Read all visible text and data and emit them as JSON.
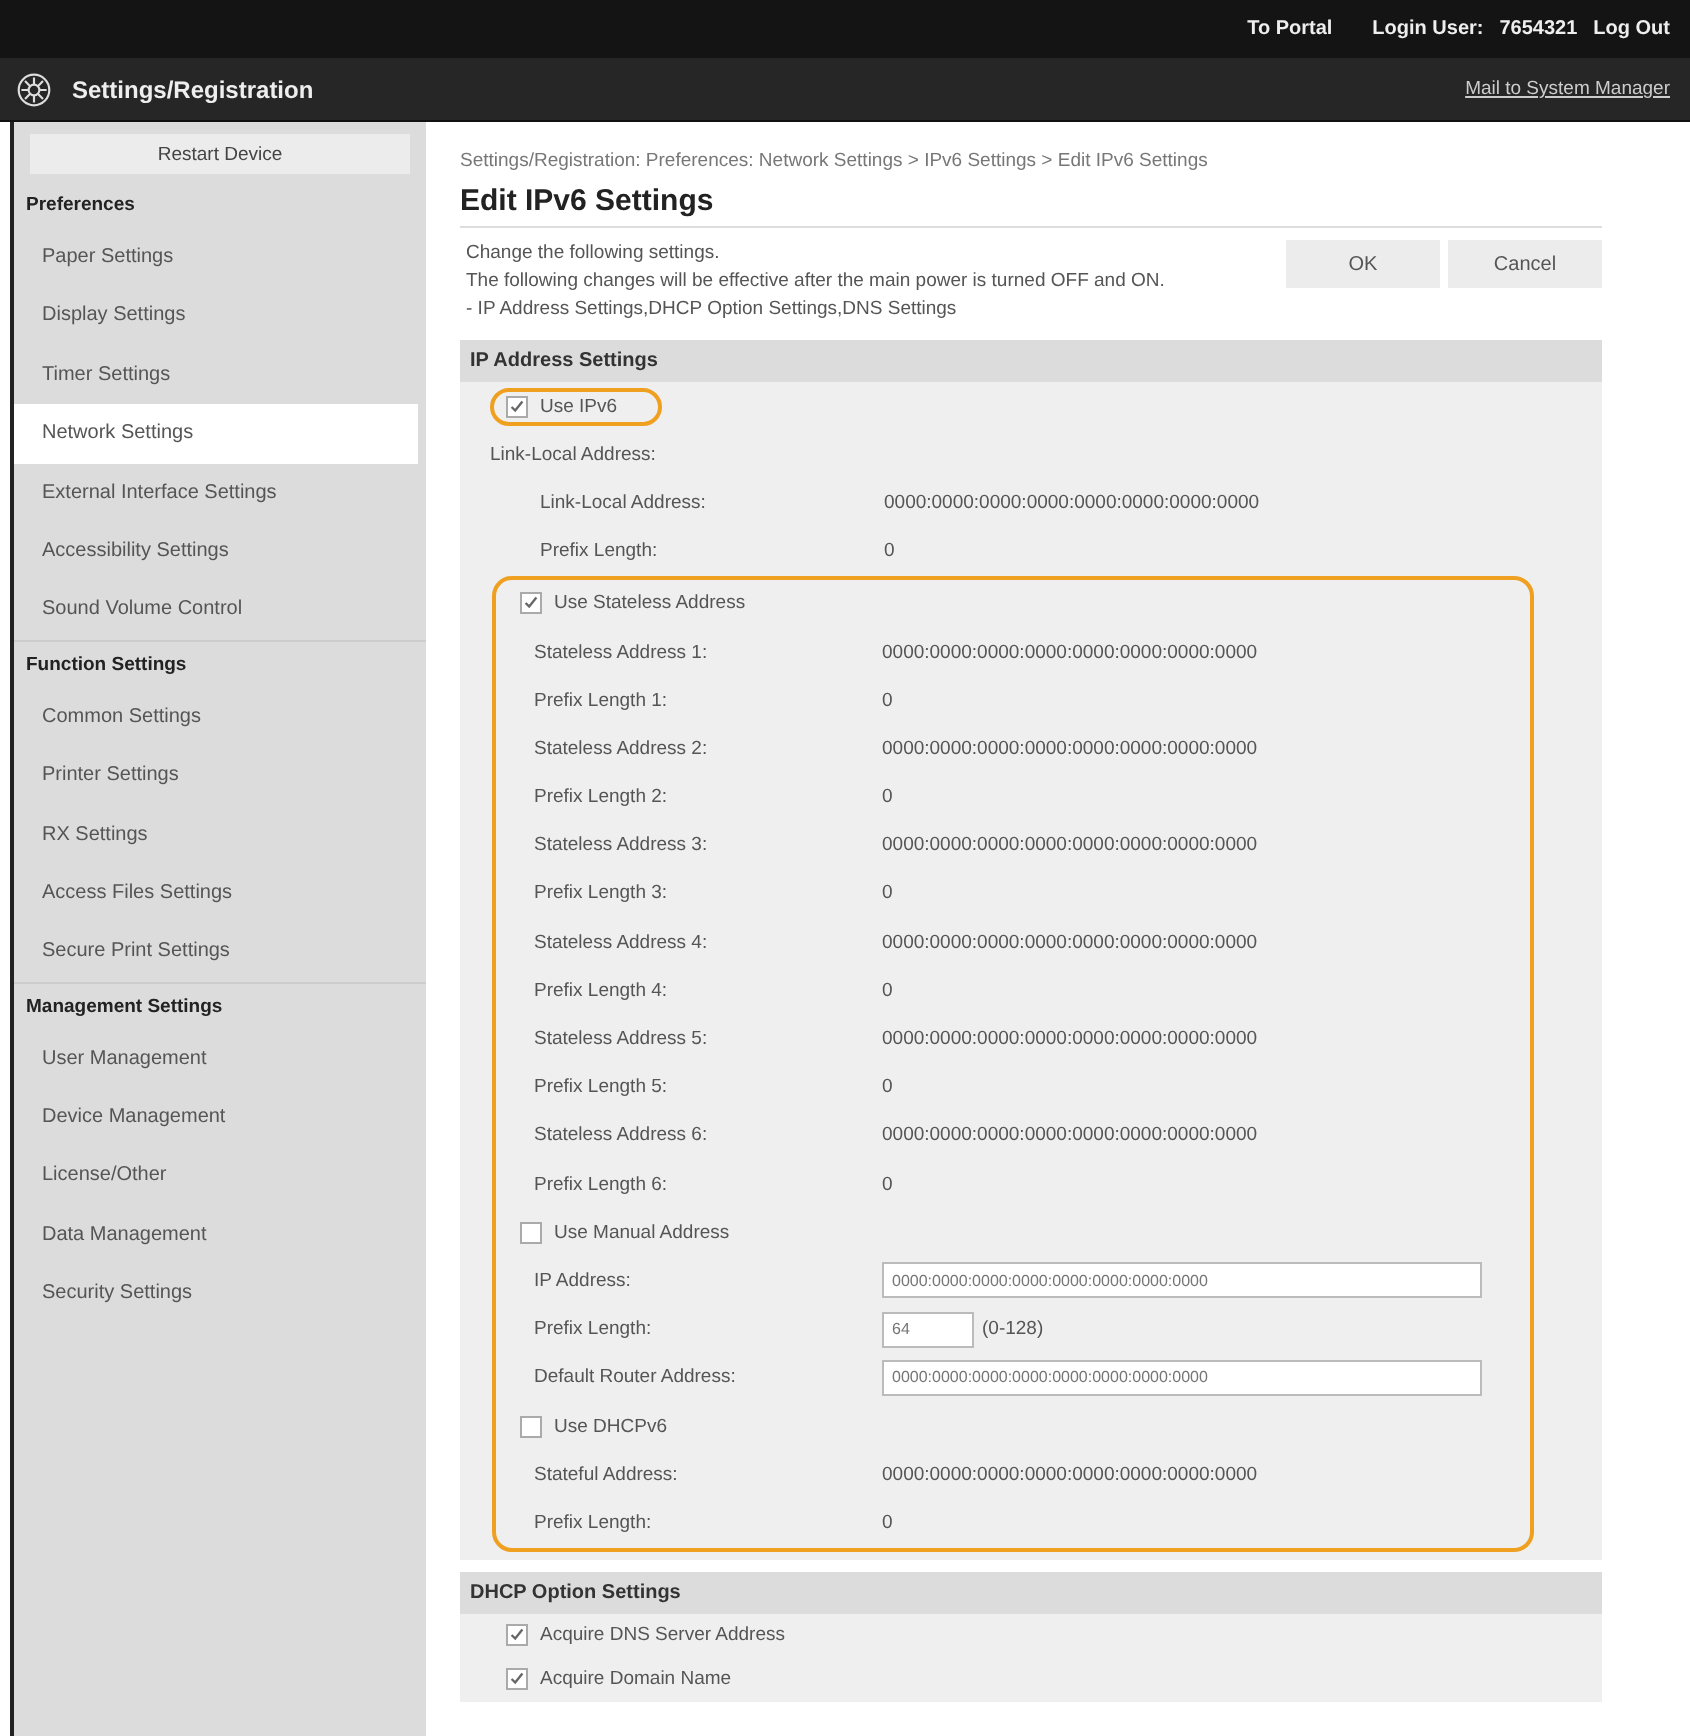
{
  "top_bar": {
    "portal_link": "To Portal",
    "login_label": "Login User:",
    "login_user": "7654321",
    "logout_link": "Log Out"
  },
  "app_bar": {
    "title": "Settings/Registration",
    "mail_link": "Mail to System Manager"
  },
  "sidebar": {
    "restart_button": "Restart Device",
    "groups": [
      {
        "title": "Preferences",
        "items": [
          {
            "label": "Paper Settings",
            "selected": false
          },
          {
            "label": "Display Settings",
            "selected": false
          },
          {
            "label": "Timer Settings",
            "selected": false
          },
          {
            "label": "Network Settings",
            "selected": true
          },
          {
            "label": "External Interface Settings",
            "selected": false
          },
          {
            "label": "Accessibility Settings",
            "selected": false
          },
          {
            "label": "Sound Volume Control",
            "selected": false
          }
        ]
      },
      {
        "title": "Function Settings",
        "items": [
          {
            "label": "Common Settings",
            "selected": false
          },
          {
            "label": "Printer Settings",
            "selected": false
          },
          {
            "label": "RX Settings",
            "selected": false
          },
          {
            "label": "Access Files Settings",
            "selected": false
          },
          {
            "label": "Secure Print Settings",
            "selected": false
          }
        ]
      },
      {
        "title": "Management Settings",
        "items": [
          {
            "label": "User Management",
            "selected": false
          },
          {
            "label": "Device Management",
            "selected": false
          },
          {
            "label": "License/Other",
            "selected": false
          },
          {
            "label": "Data Management",
            "selected": false
          },
          {
            "label": "Security Settings",
            "selected": false
          }
        ]
      }
    ]
  },
  "breadcrumb": "Settings/Registration: Preferences: Network Settings > IPv6 Settings > Edit IPv6 Settings",
  "page_title": "Edit IPv6 Settings",
  "intro": [
    "Change the following settings.",
    "The following changes will be effective after the main power is turned OFF and ON.",
    "- IP Address Settings,DHCP Option Settings,DNS Settings"
  ],
  "buttons": [
    "OK",
    "Cancel"
  ],
  "sections": [
    {
      "title": "IP Address Settings",
      "rows": [
        {
          "kind": "checkbox",
          "label": "Use IPv6",
          "checked": true,
          "highlighted": true
        },
        {
          "kind": "subheading",
          "label": "Link-Local Address:"
        },
        {
          "kind": "value",
          "label": "Link-Local Address:",
          "value": "0000:0000:0000:0000:0000:0000:0000:0000"
        },
        {
          "kind": "value",
          "label": "Prefix Length:",
          "value": "0"
        },
        {
          "kind": "group",
          "highlighted": true,
          "rows": [
            {
              "kind": "checkbox",
              "label": "Use Stateless Address",
              "checked": true
            },
            {
              "kind": "value",
              "label": "Stateless Address 1:",
              "value": "0000:0000:0000:0000:0000:0000:0000:0000"
            },
            {
              "kind": "value",
              "label": "Prefix Length 1:",
              "value": "0"
            },
            {
              "kind": "value",
              "label": "Stateless Address 2:",
              "value": "0000:0000:0000:0000:0000:0000:0000:0000"
            },
            {
              "kind": "value",
              "label": "Prefix Length 2:",
              "value": "0"
            },
            {
              "kind": "value",
              "label": "Stateless Address 3:",
              "value": "0000:0000:0000:0000:0000:0000:0000:0000"
            },
            {
              "kind": "value",
              "label": "Prefix Length 3:",
              "value": "0"
            },
            {
              "kind": "value",
              "label": "Stateless Address 4:",
              "value": "0000:0000:0000:0000:0000:0000:0000:0000"
            },
            {
              "kind": "value",
              "label": "Prefix Length 4:",
              "value": "0"
            },
            {
              "kind": "value",
              "label": "Stateless Address 5:",
              "value": "0000:0000:0000:0000:0000:0000:0000:0000"
            },
            {
              "kind": "value",
              "label": "Prefix Length 5:",
              "value": "0"
            },
            {
              "kind": "value",
              "label": "Stateless Address 6:",
              "value": "0000:0000:0000:0000:0000:0000:0000:0000"
            },
            {
              "kind": "value",
              "label": "Prefix Length 6:",
              "value": "0"
            },
            {
              "kind": "checkbox",
              "label": "Use Manual Address",
              "checked": false
            },
            {
              "kind": "input",
              "label": "IP Address:",
              "placeholder": "0000:0000:0000:0000:0000:0000:0000:0000"
            },
            {
              "kind": "short_input",
              "label": "Prefix Length:",
              "placeholder": "64",
              "hint": "(0-128)"
            },
            {
              "kind": "input",
              "label": "Default Router Address:",
              "placeholder": "0000:0000:0000:0000:0000:0000:0000:0000"
            },
            {
              "kind": "checkbox",
              "label": "Use DHCPv6",
              "checked": false
            },
            {
              "kind": "value",
              "label": "Stateful Address:",
              "value": "0000:0000:0000:0000:0000:0000:0000:0000"
            },
            {
              "kind": "value",
              "label": "Prefix Length:",
              "value": "0"
            }
          ]
        }
      ]
    },
    {
      "title": "DHCP Option Settings",
      "rows": [
        {
          "kind": "checkbox",
          "label": "Acquire DNS Server Address",
          "checked": true
        },
        {
          "kind": "checkbox",
          "label": "Acquire Domain Name",
          "checked": true
        }
      ]
    }
  ]
}
